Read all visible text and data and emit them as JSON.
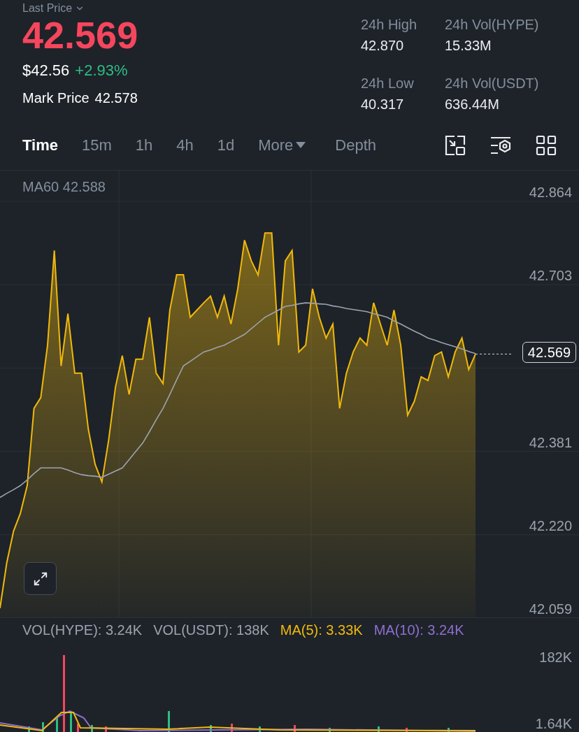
{
  "header": {
    "label": "Last Price",
    "price": "42.569",
    "usd_price": "$42.56",
    "change": "+2.93%",
    "mark_label": "Mark Price",
    "mark_value": "42.578"
  },
  "stats": [
    {
      "label": "24h High",
      "value": "42.870"
    },
    {
      "label": "24h Vol(HYPE)",
      "value": "15.33M"
    },
    {
      "label": "24h Low",
      "value": "40.317"
    },
    {
      "label": "24h Vol(USDT)",
      "value": "636.44M"
    }
  ],
  "tabs": [
    {
      "label": "Time",
      "selected": true,
      "kind": "plain"
    },
    {
      "label": "15m",
      "selected": false,
      "kind": "plain"
    },
    {
      "label": "1h",
      "selected": false,
      "kind": "plain"
    },
    {
      "label": "4h",
      "selected": false,
      "kind": "plain"
    },
    {
      "label": "1d",
      "selected": false,
      "kind": "plain"
    },
    {
      "label": "More",
      "selected": false,
      "kind": "dropdown"
    },
    {
      "label": "Depth",
      "selected": false,
      "kind": "plain"
    }
  ],
  "price_chart": {
    "legend_value": "42.588",
    "current_price": "42.569",
    "chart_data": {
      "type": "area",
      "grid": true,
      "categories": [
        null,
        null,
        null,
        null,
        null,
        null,
        null,
        null,
        null,
        null,
        null,
        null,
        null,
        null,
        null,
        null,
        null,
        null,
        null,
        null,
        null,
        null,
        null,
        null,
        null,
        null,
        null,
        null,
        null,
        null,
        null,
        null,
        null,
        null,
        null,
        null,
        null,
        null,
        null,
        null,
        null,
        null,
        null,
        null,
        null,
        null,
        null,
        null,
        null,
        null,
        null,
        null,
        null,
        null,
        null,
        null,
        null,
        null,
        null,
        null,
        null,
        null,
        null,
        null,
        null,
        null,
        null,
        null,
        null,
        null,
        null
      ],
      "ylim": [
        42.059,
        42.864
      ],
      "yticks": [
        {
          "value": 42.864,
          "label": "42.864"
        },
        {
          "value": 42.703,
          "label": "42.703"
        },
        {
          "value": 42.381,
          "label": "42.381"
        },
        {
          "value": 42.22,
          "label": "42.220"
        },
        {
          "value": 42.059,
          "label": "42.059"
        }
      ],
      "series": [
        {
          "color": "#f0b90b",
          "values": [
            42.078,
            42.166,
            42.227,
            42.261,
            42.315,
            42.464,
            42.485,
            42.586,
            42.769,
            42.546,
            42.647,
            42.532,
            42.532,
            42.424,
            42.356,
            42.322,
            42.403,
            42.505,
            42.566,
            42.491,
            42.559,
            42.559,
            42.64,
            42.532,
            42.512,
            42.654,
            42.722,
            42.722,
            42.64,
            42.654,
            42.668,
            42.681,
            42.64,
            42.681,
            42.627,
            42.695,
            42.789,
            42.749,
            42.722,
            42.803,
            42.803,
            42.586,
            42.749,
            42.769,
            42.573,
            42.586,
            42.695,
            42.64,
            42.6,
            42.627,
            42.464,
            42.532,
            42.573,
            42.6,
            42.586,
            42.668,
            42.627,
            42.586,
            42.654,
            42.586,
            42.451,
            42.478,
            42.525,
            42.518,
            42.566,
            42.573,
            42.525,
            42.573,
            42.6,
            42.539,
            42.569
          ]
        },
        {
          "name": "MA60",
          "type": "line",
          "color": "#9ca3af",
          "values": [
            42.292,
            42.3,
            42.307,
            42.315,
            42.326,
            42.338,
            42.349,
            42.349,
            42.349,
            42.349,
            42.345,
            42.34,
            42.336,
            42.334,
            42.333,
            42.331,
            42.337,
            42.343,
            42.349,
            42.365,
            42.381,
            42.397,
            42.419,
            42.442,
            42.464,
            42.491,
            42.519,
            42.546,
            42.555,
            42.564,
            42.573,
            42.577,
            42.582,
            42.586,
            42.593,
            42.6,
            42.607,
            42.618,
            42.629,
            42.64,
            42.647,
            42.654,
            42.661,
            42.663,
            42.666,
            42.668,
            42.667,
            42.666,
            42.665,
            42.662,
            42.66,
            42.657,
            42.655,
            42.653,
            42.651,
            42.647,
            42.644,
            42.64,
            42.633,
            42.627,
            42.62,
            42.613,
            42.607,
            42.6,
            42.596,
            42.591,
            42.587,
            42.583,
            42.579,
            42.574,
            42.57
          ]
        }
      ]
    }
  },
  "volume": {
    "legend": [
      {
        "text": "VOL(HYPE): 3.24K",
        "color": "#9ca3af"
      },
      {
        "text": "VOL(USDT): 138K",
        "color": "#9ca3af"
      },
      {
        "text": "MA(5): 3.33K",
        "color": "#f0b90b"
      },
      {
        "text": "MA(10): 3.24K",
        "color": "#8e6fd0"
      }
    ],
    "axis_labels": [
      "182K",
      "1.64K"
    ]
  }
}
